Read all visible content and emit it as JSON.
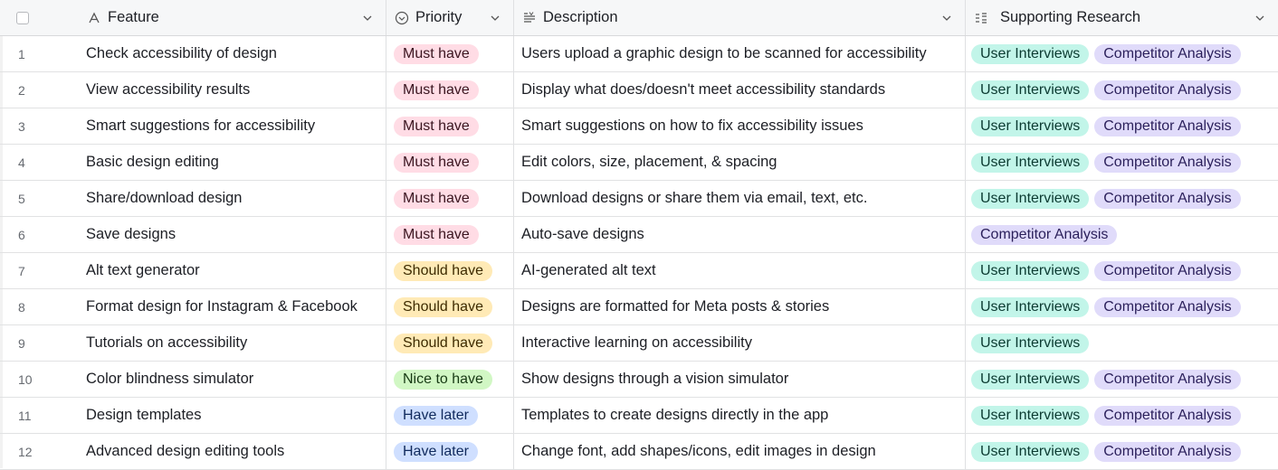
{
  "columns": {
    "feature": "Feature",
    "priority": "Priority",
    "description": "Description",
    "research": "Supporting Research"
  },
  "colors": {
    "must_have": "#ffdce5",
    "should_have": "#ffeab6",
    "nice_to_have": "#d1f7c4",
    "have_later": "#cfdfff",
    "user_interviews": "#c2f5e9",
    "competitor_analysis": "#e0dbfa"
  },
  "rows": [
    {
      "num": "1",
      "feature": "Check accessibility of design",
      "priority": "Must have",
      "priority_class": "must",
      "description": "Users upload a graphic design to be scanned for accessibility",
      "research": [
        "User Interviews",
        "Competitor Analysis"
      ]
    },
    {
      "num": "2",
      "feature": "View accessibility results",
      "priority": "Must have",
      "priority_class": "must",
      "description": "Display what does/doesn't meet accessibility standards",
      "research": [
        "User Interviews",
        "Competitor Analysis"
      ]
    },
    {
      "num": "3",
      "feature": "Smart suggestions for accessibility",
      "priority": "Must have",
      "priority_class": "must",
      "description": "Smart suggestions on how to fix accessibility issues",
      "research": [
        "User Interviews",
        "Competitor Analysis"
      ]
    },
    {
      "num": "4",
      "feature": "Basic design editing",
      "priority": "Must have",
      "priority_class": "must",
      "description": "Edit colors, size, placement, & spacing",
      "research": [
        "User Interviews",
        "Competitor Analysis"
      ]
    },
    {
      "num": "5",
      "feature": "Share/download design",
      "priority": "Must have",
      "priority_class": "must",
      "description": "Download designs or share them via email, text, etc.",
      "research": [
        "User Interviews",
        "Competitor Analysis"
      ]
    },
    {
      "num": "6",
      "feature": "Save designs",
      "priority": "Must have",
      "priority_class": "must",
      "description": "Auto-save designs",
      "research": [
        "Competitor Analysis"
      ]
    },
    {
      "num": "7",
      "feature": "Alt text generator",
      "priority": "Should have",
      "priority_class": "should",
      "description": "AI-generated alt text",
      "research": [
        "User Interviews",
        "Competitor Analysis"
      ]
    },
    {
      "num": "8",
      "feature": "Format design for Instagram & Facebook",
      "priority": "Should have",
      "priority_class": "should",
      "description": "Designs are formatted for Meta posts & stories",
      "research": [
        "User Interviews",
        "Competitor Analysis"
      ]
    },
    {
      "num": "9",
      "feature": "Tutorials on accessibility",
      "priority": "Should have",
      "priority_class": "should",
      "description": "Interactive learning on accessibility",
      "research": [
        "User Interviews"
      ]
    },
    {
      "num": "10",
      "feature": "Color blindness simulator",
      "priority": "Nice to have",
      "priority_class": "nice",
      "description": "Show designs through a vision simulator",
      "research": [
        "User Interviews",
        "Competitor Analysis"
      ]
    },
    {
      "num": "11",
      "feature": "Design templates",
      "priority": "Have later",
      "priority_class": "later",
      "description": "Templates to create designs directly in the app",
      "research": [
        "User Interviews",
        "Competitor Analysis"
      ]
    },
    {
      "num": "12",
      "feature": "Advanced design editing tools",
      "priority": "Have later",
      "priority_class": "later",
      "description": "Change font, add shapes/icons, edit images in design",
      "research": [
        "User Interviews",
        "Competitor Analysis"
      ]
    }
  ]
}
